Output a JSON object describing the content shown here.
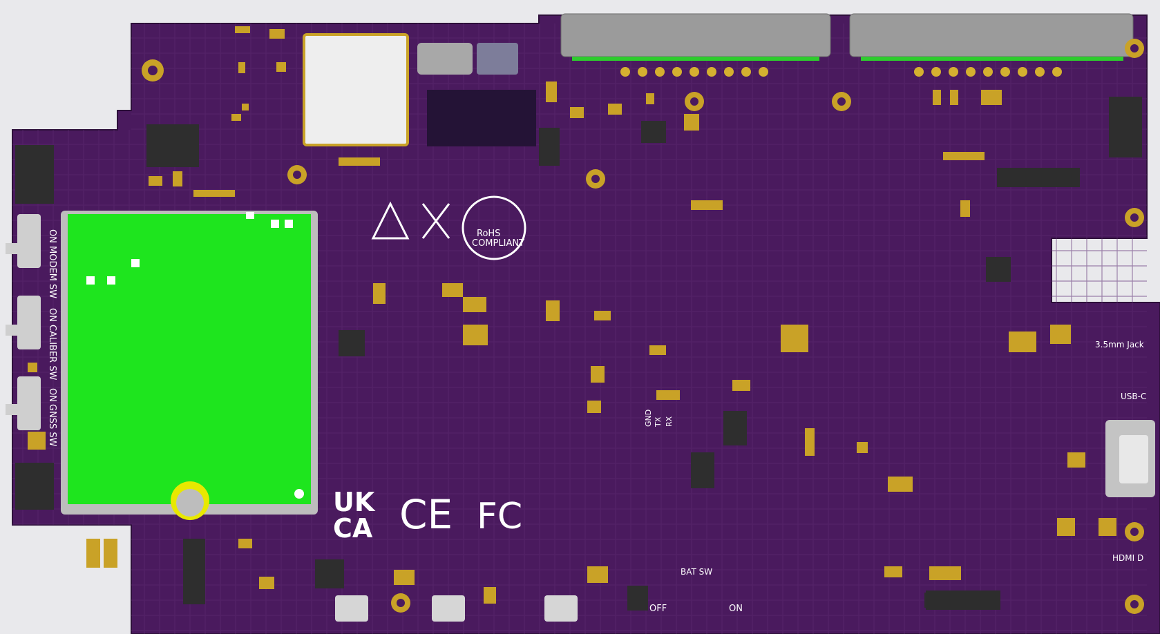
{
  "board": {
    "substrate_color": "#4a1a5e",
    "trace_color": "#5c2a72",
    "pad_color": "#c9a227",
    "silkscreen_color": "#ffffff",
    "module_color": "#1ee51e",
    "connector_color": "#9a9a9a"
  },
  "switches": [
    {
      "name": "MODEM SW",
      "state": "ON"
    },
    {
      "name": "CALIBER SW",
      "state": "ON"
    },
    {
      "name": "GNSS SW",
      "state": "ON"
    }
  ],
  "labels": {
    "jack": "3.5mm Jack",
    "usb": "USB-C",
    "hdmi": "HDMI D",
    "battery_switch": "BAT SW",
    "off": "OFF",
    "on": "ON",
    "uart_gnd": "GND",
    "uart_tx": "TX",
    "uart_rx": "RX",
    "rohs": "RoHS",
    "rohs_sub": "COMPLIANT",
    "ukca_top": "UK",
    "ukca_bottom": "CA",
    "ce": "CE",
    "fcc": "FC"
  }
}
